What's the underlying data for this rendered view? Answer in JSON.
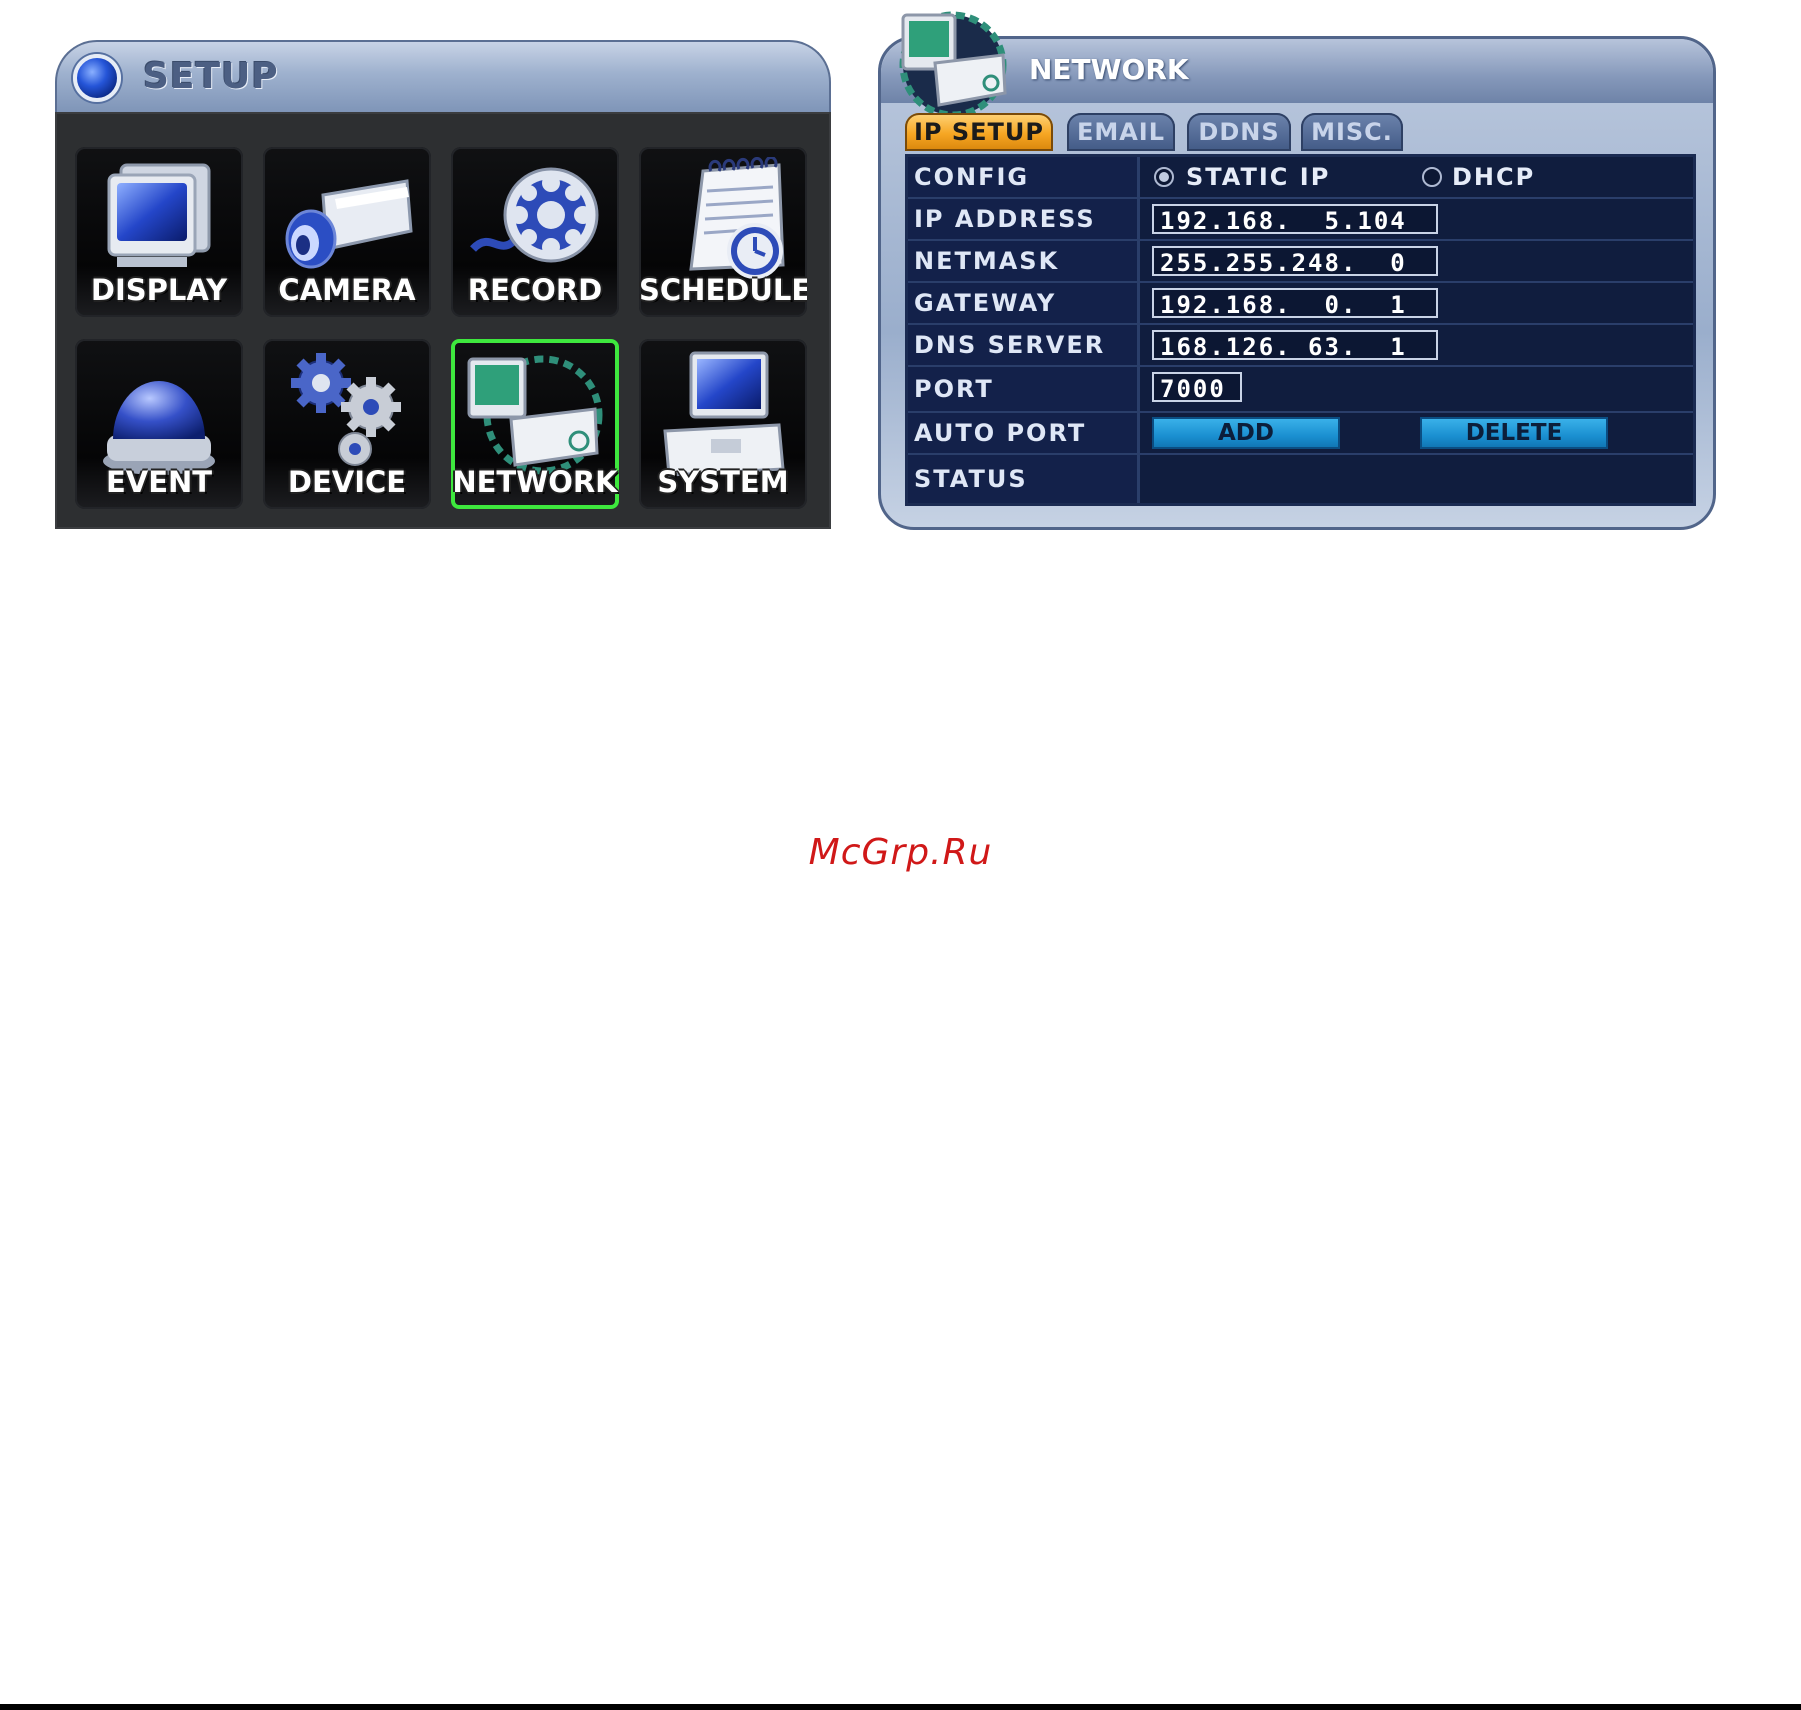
{
  "setup": {
    "title": "SETUP",
    "tiles": [
      {
        "label": "DISPLAY",
        "icon": "monitor-icon"
      },
      {
        "label": "CAMERA",
        "icon": "camera-icon"
      },
      {
        "label": "RECORD",
        "icon": "film-reel-icon"
      },
      {
        "label": "SCHEDULE",
        "icon": "schedule-clock-icon"
      },
      {
        "label": "EVENT",
        "icon": "dome-alarm-icon"
      },
      {
        "label": "DEVICE",
        "icon": "gears-icon"
      },
      {
        "label": "NETWORK",
        "icon": "network-dvr-icon",
        "selected": true
      },
      {
        "label": "SYSTEM",
        "icon": "computer-system-icon"
      }
    ]
  },
  "network": {
    "title": "NETWORK",
    "tabs": [
      {
        "label": "IP SETUP",
        "active": true
      },
      {
        "label": "EMAIL"
      },
      {
        "label": "DDNS"
      },
      {
        "label": "MISC."
      }
    ],
    "rows": {
      "config": {
        "label": "CONFIG",
        "option_static": "STATIC IP",
        "option_dhcp": "DHCP",
        "selected": "STATIC IP"
      },
      "ip_address": {
        "label": "IP ADDRESS",
        "value": "192.168.  5.104"
      },
      "netmask": {
        "label": "NETMASK",
        "value": "255.255.248.  0"
      },
      "gateway": {
        "label": "GATEWAY",
        "value": "192.168.  0.  1"
      },
      "dns_server": {
        "label": "DNS SERVER",
        "value": "168.126. 63.  1"
      },
      "port": {
        "label": "PORT",
        "value": "7000"
      },
      "auto_port": {
        "label": "AUTO PORT",
        "add_label": "ADD",
        "delete_label": "DELETE"
      },
      "status": {
        "label": "STATUS",
        "value": ""
      }
    }
  },
  "watermark": "McGrp.Ru",
  "colors": {
    "selected_tile": "#3ee83e",
    "active_tab": "#f6a623",
    "button": "#1a8fd0"
  }
}
